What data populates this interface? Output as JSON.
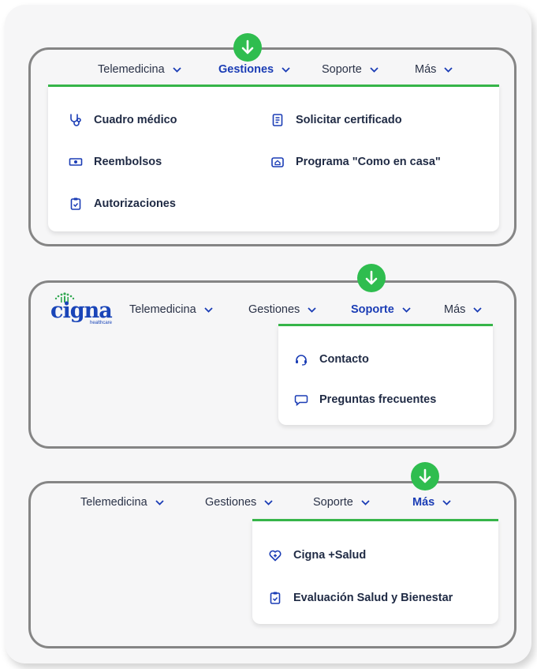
{
  "colors": {
    "accent_blue": "#1b3db5",
    "accent_green": "#36b549",
    "marker_green": "#2fbd4f",
    "panel_border": "#858585"
  },
  "panel1": {
    "nav": [
      {
        "label": "Telemedicina",
        "active": false
      },
      {
        "label": "Gestiones",
        "active": true
      },
      {
        "label": "Soporte",
        "active": false
      },
      {
        "label": "Más",
        "active": false
      }
    ],
    "menu": [
      {
        "label": "Cuadro médico",
        "icon": "stethoscope-icon"
      },
      {
        "label": "Solicitar certificado",
        "icon": "document-icon"
      },
      {
        "label": "Reembolsos",
        "icon": "banknote-icon"
      },
      {
        "label": "Programa \"Como en casa\"",
        "icon": "home-care-icon"
      },
      {
        "label": "Autorizaciones",
        "icon": "clipboard-check-icon"
      }
    ]
  },
  "panel2": {
    "logo": {
      "word": "cigna",
      "sub": "healthcare"
    },
    "nav": [
      {
        "label": "Telemedicina",
        "active": false
      },
      {
        "label": "Gestiones",
        "active": false
      },
      {
        "label": "Soporte",
        "active": true
      },
      {
        "label": "Más",
        "active": false
      }
    ],
    "menu": [
      {
        "label": "Contacto",
        "icon": "headset-icon"
      },
      {
        "label": "Preguntas frecuentes",
        "icon": "chat-bubble-icon"
      }
    ]
  },
  "panel3": {
    "nav": [
      {
        "label": "Telemedicina",
        "active": false
      },
      {
        "label": "Gestiones",
        "active": false
      },
      {
        "label": "Soporte",
        "active": false
      },
      {
        "label": "Más",
        "active": true
      }
    ],
    "menu": [
      {
        "label": "Cigna +Salud",
        "icon": "heart-plus-icon"
      },
      {
        "label": "Evaluación Salud y Bienestar",
        "icon": "clipboard-check-icon"
      }
    ]
  }
}
